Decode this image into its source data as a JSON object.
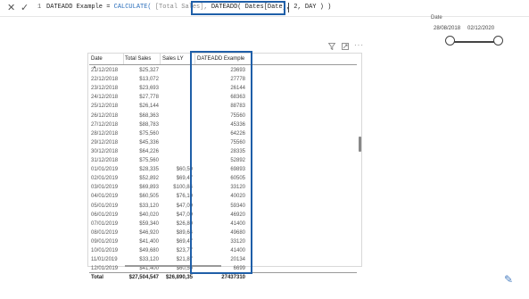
{
  "formula_bar": {
    "cancel_icon": "close-icon",
    "commit_icon": "checkmark-icon",
    "line_number": "1",
    "measure_name": "DATEADD Example =",
    "fn_calculate": "CALCULATE(",
    "arg_total_sales": "[Total Sales],",
    "dateadd_expr": "DATEADD( Dates[Date], 2, DAY ) )"
  },
  "slicer": {
    "title": "Date",
    "start_date": "28/08/2018",
    "end_date": "02/12/2020"
  },
  "visual_header_icons": [
    "filter-icon",
    "focus-mode-icon",
    "more-options-icon"
  ],
  "table": {
    "columns": [
      "Date",
      "Total Sales",
      "Sales LY",
      "DATEADD Example"
    ],
    "rows": [
      [
        "21/12/2018",
        "$25,327",
        "",
        "23693"
      ],
      [
        "22/12/2018",
        "$13,072",
        "",
        "27778"
      ],
      [
        "23/12/2018",
        "$23,693",
        "",
        "26144"
      ],
      [
        "24/12/2018",
        "$27,778",
        "",
        "68363"
      ],
      [
        "25/12/2018",
        "$26,144",
        "",
        "88783"
      ],
      [
        "26/12/2018",
        "$68,363",
        "",
        "75560"
      ],
      [
        "27/12/2018",
        "$88,783",
        "",
        "45336"
      ],
      [
        "28/12/2018",
        "$75,560",
        "",
        "64226"
      ],
      [
        "29/12/2018",
        "$45,336",
        "",
        "75560"
      ],
      [
        "30/12/2018",
        "$64,226",
        "",
        "28335"
      ],
      [
        "31/12/2018",
        "$75,560",
        "",
        "52892"
      ],
      [
        "01/01/2019",
        "$28,335",
        "$60,50",
        "69893"
      ],
      [
        "02/01/2019",
        "$52,892",
        "$69,47",
        "60505"
      ],
      [
        "03/01/2019",
        "$69,893",
        "$100,84",
        "33120"
      ],
      [
        "04/01/2019",
        "$60,505",
        "$76,10",
        "40020"
      ],
      [
        "05/01/2019",
        "$33,120",
        "$47,09",
        "59340"
      ],
      [
        "06/01/2019",
        "$40,020",
        "$47,09",
        "46920"
      ],
      [
        "07/01/2019",
        "$59,340",
        "$26,80",
        "41400"
      ],
      [
        "08/01/2019",
        "$46,920",
        "$89,64",
        "49680"
      ],
      [
        "09/01/2019",
        "$41,400",
        "$69,47",
        "33120"
      ],
      [
        "10/01/2019",
        "$49,680",
        "$23,77",
        "41400"
      ],
      [
        "11/01/2019",
        "$33,120",
        "$21,87",
        "20134"
      ],
      [
        "12/01/2019",
        "$41,400",
        "$60,50",
        "6699"
      ]
    ],
    "total": [
      "Total",
      "$27,504,547",
      "$26,890,35",
      "27437310"
    ]
  }
}
